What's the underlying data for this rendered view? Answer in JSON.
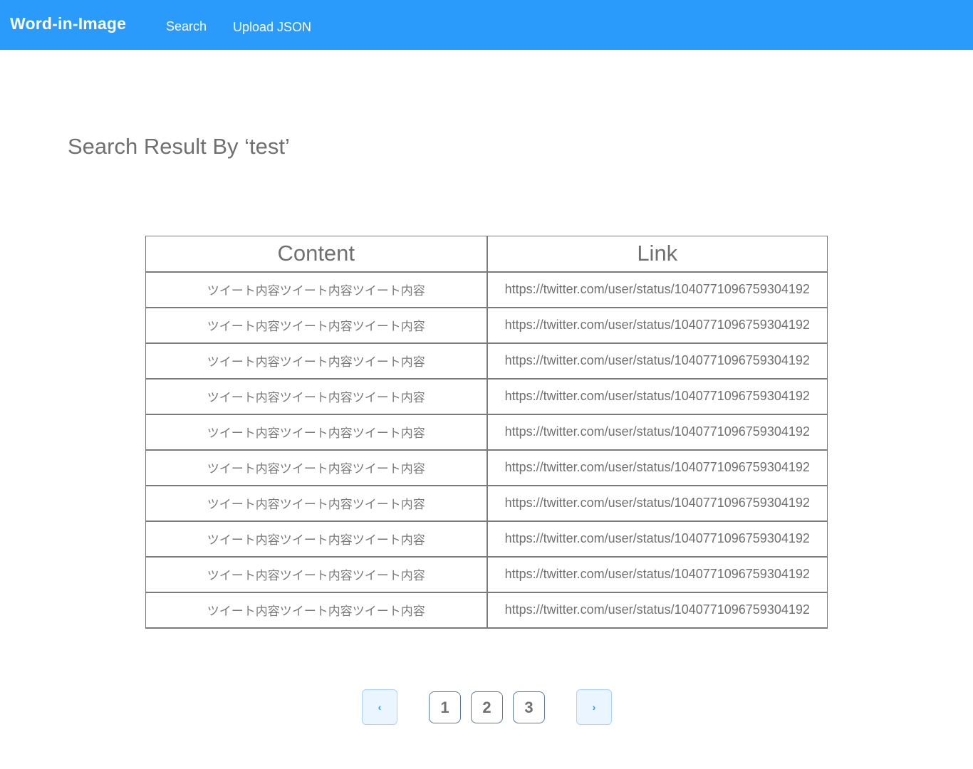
{
  "app": {
    "brand": "Word-in-Image",
    "nav": {
      "search": "Search",
      "upload": "Upload JSON"
    }
  },
  "page": {
    "title": "Search Result By ‘test’"
  },
  "table": {
    "headers": {
      "content": "Content",
      "link": "Link"
    },
    "rows": [
      {
        "content": "ツイート内容ツイート内容ツイート内容",
        "link": "https://twitter.com/user/status/1040771096759304192"
      },
      {
        "content": "ツイート内容ツイート内容ツイート内容",
        "link": "https://twitter.com/user/status/1040771096759304192"
      },
      {
        "content": "ツイート内容ツイート内容ツイート内容",
        "link": "https://twitter.com/user/status/1040771096759304192"
      },
      {
        "content": "ツイート内容ツイート内容ツイート内容",
        "link": "https://twitter.com/user/status/1040771096759304192"
      },
      {
        "content": "ツイート内容ツイート内容ツイート内容",
        "link": "https://twitter.com/user/status/1040771096759304192"
      },
      {
        "content": "ツイート内容ツイート内容ツイート内容",
        "link": "https://twitter.com/user/status/1040771096759304192"
      },
      {
        "content": "ツイート内容ツイート内容ツイート内容",
        "link": "https://twitter.com/user/status/1040771096759304192"
      },
      {
        "content": "ツイート内容ツイート内容ツイート内容",
        "link": "https://twitter.com/user/status/1040771096759304192"
      },
      {
        "content": "ツイート内容ツイート内容ツイート内容",
        "link": "https://twitter.com/user/status/1040771096759304192"
      },
      {
        "content": "ツイート内容ツイート内容ツイート内容",
        "link": "https://twitter.com/user/status/1040771096759304192"
      }
    ]
  },
  "pagination": {
    "prev_icon": "chevron-left-icon",
    "next_icon": "chevron-right-icon",
    "prev_glyph": "‹",
    "next_glyph": "›",
    "pages": [
      "1",
      "2",
      "3"
    ]
  },
  "colors": {
    "navbar": "#2a9bfb",
    "text": "#707070",
    "border": "#7a7a7a"
  }
}
